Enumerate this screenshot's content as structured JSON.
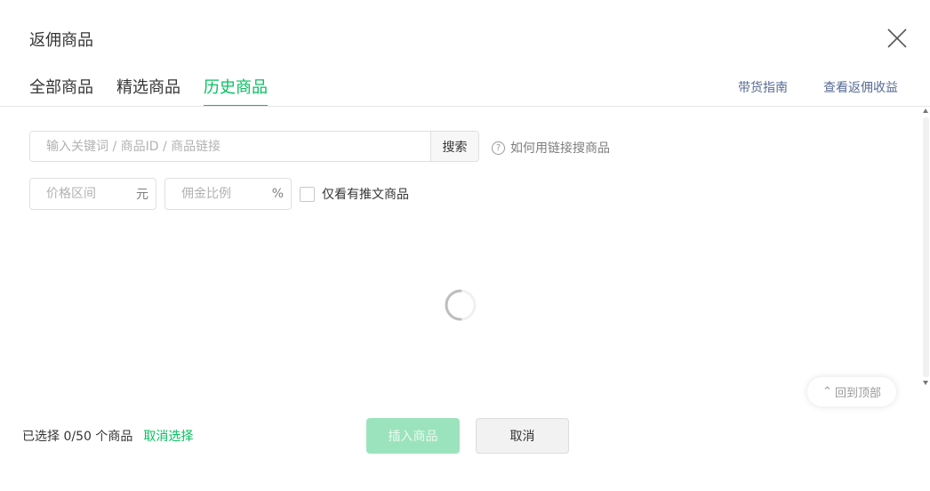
{
  "dialog": {
    "title": "返佣商品"
  },
  "tabs": [
    {
      "label": "全部商品",
      "active": false
    },
    {
      "label": "精选商品",
      "active": false
    },
    {
      "label": "历史商品",
      "active": true
    }
  ],
  "top_links": {
    "guide": "带货指南",
    "earnings": "查看返佣收益"
  },
  "search": {
    "placeholder": "输入关键词 / 商品ID / 商品链接",
    "value": "",
    "button_label": "搜索",
    "help_text": "如何用链接搜商品",
    "help_icon": "?"
  },
  "filters": {
    "price_placeholder": "价格区间",
    "price_unit": "元",
    "commission_placeholder": "佣金比例",
    "commission_unit": "%",
    "only_with_articles_label": "仅看有推文商品",
    "only_with_articles_checked": false
  },
  "back_to_top": {
    "icon": "⌃",
    "label": "回到顶部"
  },
  "footer": {
    "selected_text": "已选择 0/50 个商品",
    "cancel_selection": "取消选择",
    "insert_button": "插入商品",
    "cancel_button": "取消"
  },
  "colors": {
    "accent": "#07c160",
    "accent_disabled": "#9be3bc",
    "link": "#576b95"
  }
}
